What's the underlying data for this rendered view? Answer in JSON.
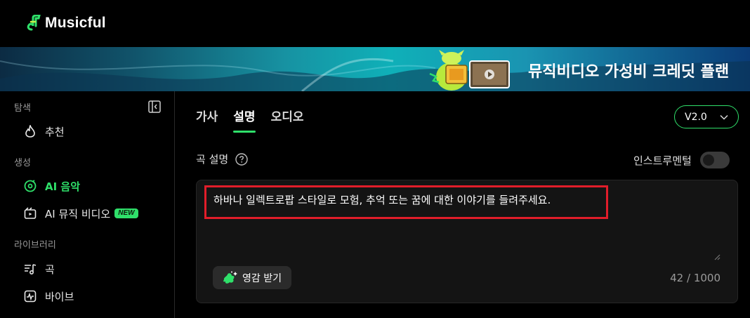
{
  "app": {
    "name": "Musicful"
  },
  "banner": {
    "text": "뮤직비디오 가성비 크레딧 플랜"
  },
  "sidebar": {
    "sections": [
      {
        "label": "탐색"
      },
      {
        "label": "생성"
      },
      {
        "label": "라이브러리"
      }
    ],
    "items": [
      {
        "label": "추천",
        "icon": "flame-icon"
      },
      {
        "label": "AI 음악",
        "icon": "music-disc-icon",
        "active": true
      },
      {
        "label": "AI 뮤직 비디오",
        "icon": "video-icon",
        "badge": "NEW"
      },
      {
        "label": "곡",
        "icon": "playlist-icon"
      },
      {
        "label": "바이브",
        "icon": "pulse-icon"
      }
    ]
  },
  "main": {
    "tabs": [
      {
        "label": "가사"
      },
      {
        "label": "설명",
        "active": true
      },
      {
        "label": "오디오"
      }
    ],
    "version": "V2.0",
    "description_label": "곡 설명",
    "instrumental_label": "인스트루멘털",
    "prompt_text": "하바나 일렉트로팝 스타일로 모험, 추억 또는 꿈에 대한 이야기를 들려주세요.",
    "inspire_label": "영감 받기",
    "counter": "42 / 1000"
  },
  "colors": {
    "accent": "#2fe06a",
    "highlight": "#e11d2a",
    "background": "#000000"
  }
}
